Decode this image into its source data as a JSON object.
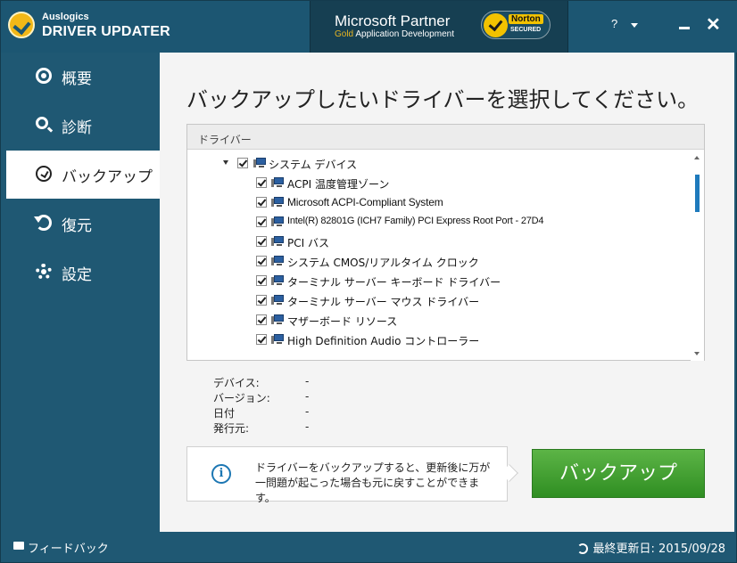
{
  "header": {
    "brand_small": "Auslogics",
    "brand_big": "DRIVER UPDATER",
    "partner_title": "Microsoft Partner",
    "partner_sub_gold": "Gold",
    "partner_sub_rest": " Application Development",
    "norton_name": "Norton",
    "norton_secured": "SECURED",
    "help_label": "?"
  },
  "sidebar": {
    "items": [
      {
        "label": "概要",
        "icon": "overview-icon"
      },
      {
        "label": "診断",
        "icon": "search-icon"
      },
      {
        "label": "バックアップ",
        "icon": "clock-icon",
        "active": true
      },
      {
        "label": "復元",
        "icon": "restore-icon"
      },
      {
        "label": "設定",
        "icon": "gear-icon"
      }
    ]
  },
  "main": {
    "title": "バックアップしたいドライバーを選択してください。",
    "driver_header": "ドライバー",
    "tree": {
      "group_label": "システム デバイス",
      "items": [
        "ACPI 温度管理ゾーン",
        "Microsoft ACPI-Compliant System",
        "Intel(R) 82801G (ICH7 Family) PCI Express Root Port - 27D4",
        "PCI バス",
        "システム CMOS/リアルタイム クロック",
        "ターミナル サーバー キーボード ドライバー",
        "ターミナル サーバー マウス ドライバー",
        "マザーボード リソース",
        "High Definition Audio コントローラー"
      ]
    },
    "details": [
      {
        "label": "デバイス:",
        "value": "-"
      },
      {
        "label": "バージョン:",
        "value": "-"
      },
      {
        "label": "日付",
        "value": "-"
      },
      {
        "label": "発行元:",
        "value": "-"
      }
    ],
    "info_icon_glyph": "i",
    "info_text": "ドライバーをバックアップすると、更新後に万が一問題が起こった場合も元に戻すことができます。",
    "backup_button": "バックアップ"
  },
  "footer": {
    "feedback": "フィードバック",
    "last_update": "最終更新日: 2015/09/28"
  },
  "colors": {
    "sidebar_bg": "#1f5873",
    "accent_green": "#3a9a2c",
    "scroll_blue": "#1e7abc"
  }
}
